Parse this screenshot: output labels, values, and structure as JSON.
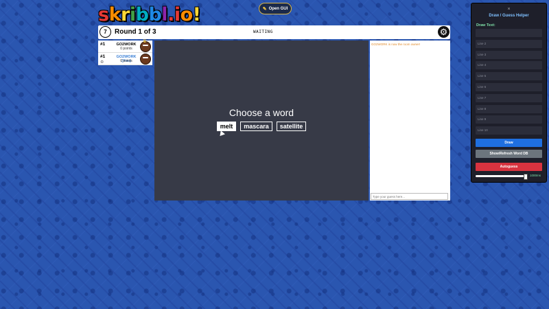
{
  "logo": {
    "letters": [
      "s",
      "k",
      "r",
      "i",
      "b",
      "b",
      "l",
      ".",
      "i",
      "o",
      "!"
    ],
    "colors": [
      "#e53935",
      "#fb8c00",
      "#fdd835",
      "#43a047",
      "#00acc1",
      "#1e88e5",
      "#8e24aa",
      "#e53935",
      "#e53935",
      "#fb8c00",
      "#fdd835"
    ]
  },
  "top": {
    "open_gui": "Open GUI",
    "timer": "7",
    "round": "Round 1 of 3",
    "status": "WAITING"
  },
  "players": [
    {
      "rank": "#1",
      "name": "GO2WORK",
      "points": "0 points",
      "owner": true
    },
    {
      "rank": "#1",
      "name": "GO2WORK (You)",
      "points": "0 points",
      "owner": false
    }
  ],
  "canvas": {
    "prompt": "Choose a word",
    "words": [
      "melt",
      "mascara",
      "satellite"
    ]
  },
  "chat": {
    "message": "GO2WORK is now the room owner!",
    "placeholder": "Type your guess here..."
  },
  "helper": {
    "close": "×",
    "title": "Draw / Guess Helper",
    "draw_text_label": "Draw Text:",
    "lines": [
      "",
      "Line 2",
      "Line 3",
      "Line 4",
      "Line 5",
      "Line 6",
      "Line 7",
      "Line 8",
      "Line 9",
      "Line 10"
    ],
    "draw_button": "Draw",
    "show_button": "Show/Refresh Word DB",
    "autoguess_button": "Autoguess",
    "slider_value": "1000ms"
  },
  "colors": {
    "background": "#2a56b0",
    "canvas": "#373a47",
    "helper_bg": "#1e1f2a"
  }
}
